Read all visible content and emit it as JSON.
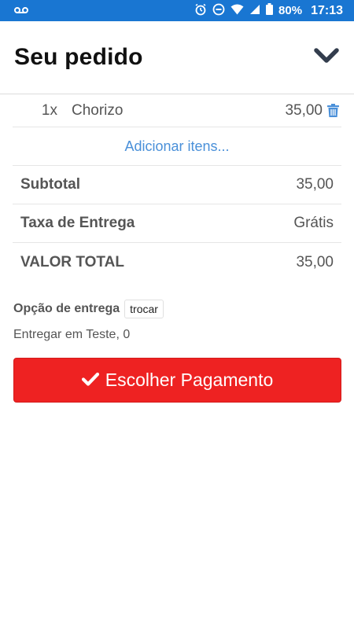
{
  "status_bar": {
    "battery": "80%",
    "time": "17:13"
  },
  "header": {
    "title": "Seu pedido",
    "collapse_icon": "chevron-down-icon"
  },
  "order": {
    "items": [
      {
        "quantity": "1x",
        "name": "Chorizo",
        "price": "35,00",
        "delete_icon": "trash-icon"
      }
    ],
    "add_items_label": "Adicionar itens..."
  },
  "summary": {
    "subtotal": {
      "label": "Subtotal",
      "value": "35,00"
    },
    "delivery_fee": {
      "label": "Taxa de Entrega",
      "value": "Grátis"
    },
    "total": {
      "label": "VALOR TOTAL",
      "value": "35,00"
    }
  },
  "delivery": {
    "option_label": "Opção de entrega",
    "change_label": "trocar",
    "address": "Entregar em Teste, 0"
  },
  "payment_button": {
    "label": "Escolher Pagamento",
    "icon": "check-icon"
  },
  "colors": {
    "status_bar": "#1976d2",
    "link": "#4a90d9",
    "primary_button": "#ee2222"
  }
}
